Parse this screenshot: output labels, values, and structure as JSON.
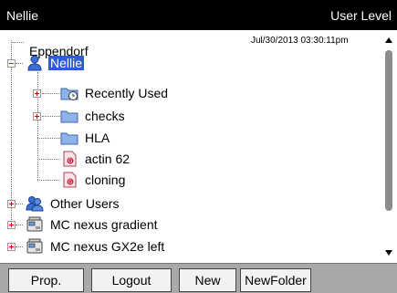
{
  "header": {
    "title": "Nellie",
    "level": "User Level"
  },
  "tree": {
    "timestamp": "Jul/30/2013 03:30:11pm",
    "root": {
      "label": "Eppendorf"
    },
    "user": {
      "label": "Nellie",
      "icon": "user-icon"
    },
    "user_children": [
      {
        "label": "Recently Used",
        "icon": "folder-clock-icon",
        "expandable": true
      },
      {
        "label": "checks",
        "icon": "folder-icon",
        "expandable": true
      },
      {
        "label": "HLA",
        "icon": "folder-icon",
        "expandable": false
      },
      {
        "label": "actin 62",
        "icon": "gradient-file-icon",
        "expandable": false
      },
      {
        "label": "cloning",
        "icon": "gradient-file-icon",
        "expandable": false
      }
    ],
    "other_users": {
      "label": "Other Users",
      "icon": "users-icon"
    },
    "devices": [
      {
        "label": "MC nexus gradient",
        "icon": "thermocycler-icon"
      },
      {
        "label": "MC nexus GX2e left",
        "icon": "thermocycler-icon"
      }
    ]
  },
  "toolbar": {
    "prop_label": "Prop.",
    "logout_label": "Logout",
    "new_label": "New",
    "newfolder_label": "NewFolder"
  },
  "colors": {
    "selection": "#2e5bd6",
    "toolbar_bg": "#a8a8a8",
    "titlebar_bg": "#000000"
  }
}
